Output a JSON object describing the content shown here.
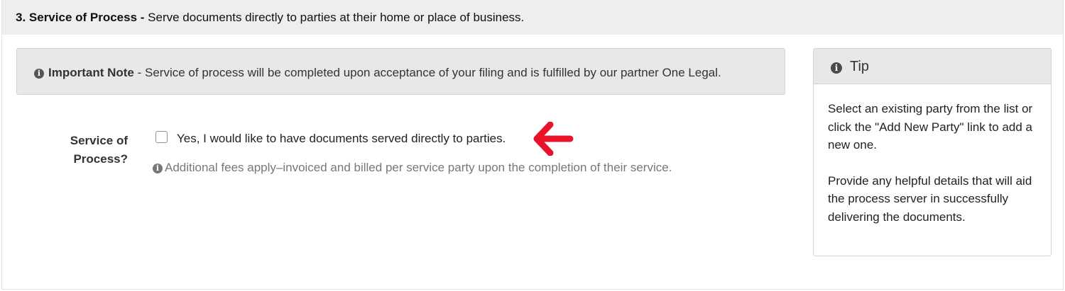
{
  "section": {
    "number_title": "3. Service of Process -",
    "description": "Serve documents directly to parties at their home or place of business."
  },
  "note": {
    "title": "Important Note",
    "text": "- Service of process will be completed upon acceptance of your filing and is fulfilled by our partner One Legal."
  },
  "form": {
    "label_line1": "Service of",
    "label_line2": "Process?",
    "checkbox_label": "Yes, I would like to have documents served directly to parties.",
    "checkbox_checked": false,
    "help_text": "Additional fees apply–invoiced and billed per service party upon the completion of their service."
  },
  "tip": {
    "title": "Tip",
    "paragraph1": "Select an existing party from the list or click the \"Add New Party\" link to add a new one.",
    "paragraph2": "Provide any helpful details that will aid the process server in successfully delivering the documents."
  },
  "icons": {
    "info": "info-circle-icon",
    "arrow": "red-arrow-left-icon"
  },
  "colors": {
    "arrow": "#e8132b",
    "header_bg": "#eeeeee",
    "note_bg": "#e8e8e8"
  }
}
